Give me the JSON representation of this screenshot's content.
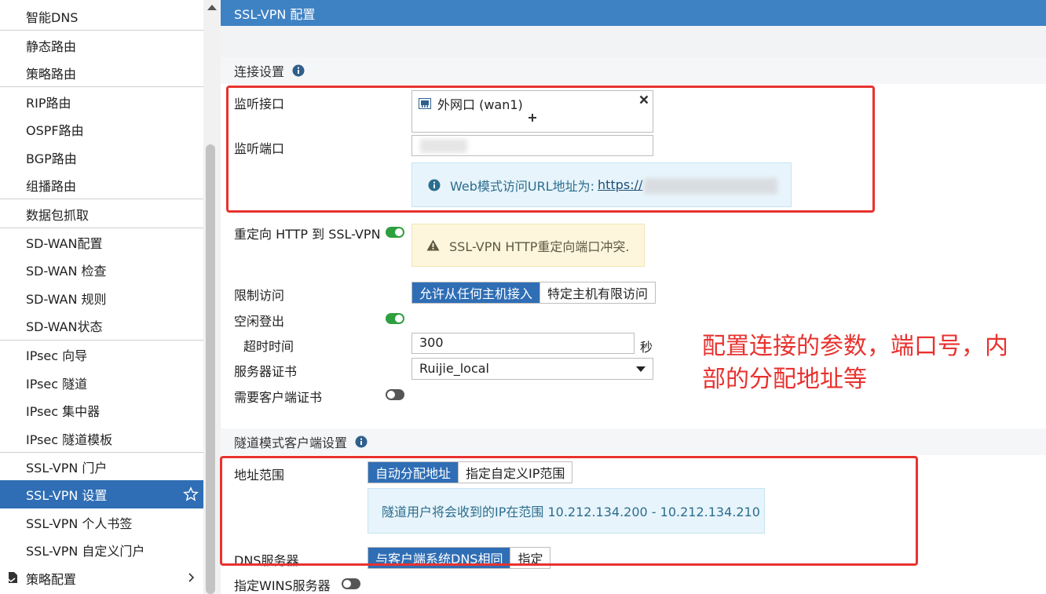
{
  "sidebar": {
    "items": [
      {
        "label": "智能DNS"
      },
      {
        "label": "静态路由"
      },
      {
        "label": "策略路由"
      },
      {
        "label": "RIP路由"
      },
      {
        "label": "OSPF路由"
      },
      {
        "label": "BGP路由"
      },
      {
        "label": "组播路由"
      },
      {
        "label": "数据包抓取"
      },
      {
        "label": "SD-WAN配置"
      },
      {
        "label": "SD-WAN 检查"
      },
      {
        "label": "SD-WAN 规则"
      },
      {
        "label": "SD-WAN状态"
      },
      {
        "label": "IPsec 向导"
      },
      {
        "label": "IPsec 隧道"
      },
      {
        "label": "IPsec 集中器"
      },
      {
        "label": "IPsec 隧道模板"
      },
      {
        "label": "SSL-VPN 门户"
      },
      {
        "label": "SSL-VPN 设置"
      },
      {
        "label": "SSL-VPN 个人书签"
      },
      {
        "label": "SSL-VPN 自定义门户"
      },
      {
        "label": "策略配置"
      }
    ],
    "active_index": 17
  },
  "header": {
    "title": "SSL-VPN 配置"
  },
  "connection": {
    "section_title": "连接设置",
    "listen_interface_label": "监听接口",
    "interface_value": "外网口 (wan1)",
    "listen_port_label": "监听端口",
    "web_url_text": "Web模式访问URL地址为:",
    "web_url_link": "https://",
    "redirect_label": "重定向 HTTP 到 SSL-VPN",
    "redirect_on": true,
    "redirect_warning": "SSL-VPN HTTP重定向端口冲突.",
    "restrict_label": "限制访问",
    "restrict_opt_any": "允许从任何主机接入",
    "restrict_opt_limited": "特定主机有限访问",
    "idle_logout_label": "空闲登出",
    "idle_logout_on": true,
    "timeout_label": "超时时间",
    "timeout_value": "300",
    "timeout_unit": "秒",
    "cert_label": "服务器证书",
    "cert_value": "Ruijie_local",
    "client_cert_label": "需要客户端证书",
    "client_cert_on": false
  },
  "tunnel": {
    "section_title": "隧道模式客户端设置",
    "address_range_label": "地址范围",
    "addr_opt_auto": "自动分配地址",
    "addr_opt_custom": "指定自定义IP范围",
    "range_info": "隧道用户将会收到的IP在范围 10.212.134.200 - 10.212.134.210",
    "dns_label": "DNS服务器",
    "dns_opt_same": "与客户端系统DNS相同",
    "dns_opt_specify": "指定",
    "wins_label": "指定WINS服务器",
    "wins_on": false
  },
  "annotation": {
    "line1": "配置连接的参数，端口号，内",
    "line2": "部的分配地址等",
    "color": "#e8322f"
  },
  "colors": {
    "header": "#3f82c4",
    "active": "#2f6eb5",
    "toggle_on": "#2ea03f"
  }
}
